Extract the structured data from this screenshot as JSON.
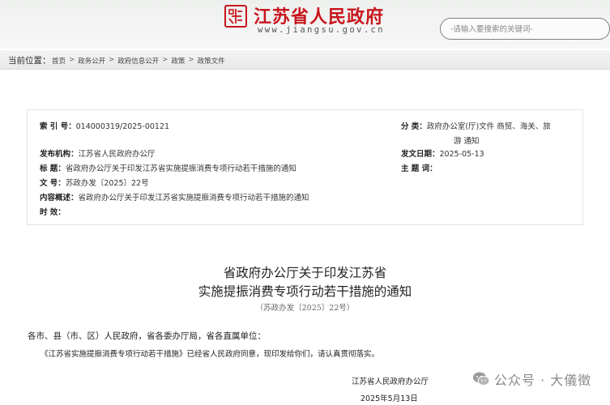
{
  "header": {
    "site_title": "江苏省人民政府",
    "site_url": "www.jiangsu.gov.cn",
    "brand_color": "#c8161d",
    "search_placeholder": "-请输入要搜索的关键词-"
  },
  "breadcrumb": {
    "label": "当前位置：",
    "items": [
      "首页",
      "政务公开",
      "政府信息公开",
      "政策",
      "政策文件"
    ],
    "separator": ">"
  },
  "info": {
    "index_label": "索  引  号：",
    "index_value": "014000319/2025-00121",
    "category_label": "分        类：",
    "category_value_line1": "政府办公室(厅)文件 商贸、海关、旅",
    "category_value_line2": "游 通知",
    "publisher_label": "发布机构：",
    "publisher_value": "江苏省人民政府办公厅",
    "date_label": "发文日期：",
    "date_value": "2025-05-13",
    "title_label": "标        题：",
    "title_value": "省政府办公厅关于印发江苏省实施提振消费专项行动若干措施的通知",
    "subject_label": "主  题  词：",
    "docno_label": "文        号：",
    "docno_value": "苏政办发〔2025〕22号",
    "summary_label": "内容概述：",
    "summary_value": "省政府办公厅关于印发江苏省实施提振消费专项行动若干措施的通知",
    "validity_label": "时        效："
  },
  "article": {
    "title_line1": "省政府办公厅关于印发江苏省",
    "title_line2": "实施提振消费专项行动若干措施的通知",
    "doc_number": "（苏政办发〔2025〕22号）",
    "addressee": "各市、县（市、区）人民政府，省各委办厅局，省各直属单位：",
    "body": "《江苏省实施提振消费专项行动若干措施》已经省人民政府同意，现印发给你们，请认真贯彻落实。",
    "signature_org": "江苏省人民政府办公厅",
    "signature_date": "2025年5月13日"
  },
  "watermark": {
    "text": "公众号 · 大儀徵",
    "icon": "wechat-icon"
  }
}
